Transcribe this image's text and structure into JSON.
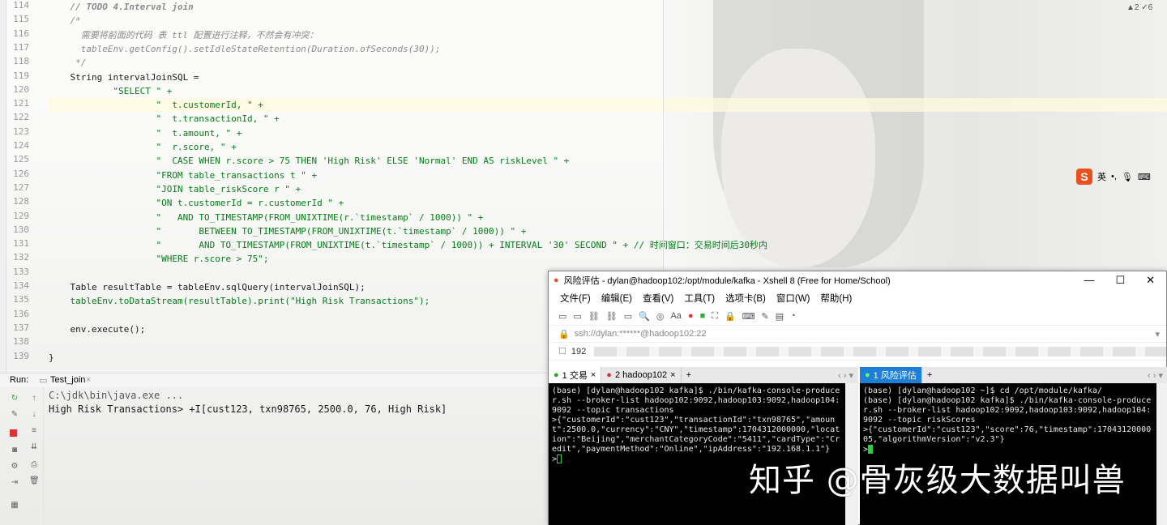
{
  "editor": {
    "line_numbers": [
      "114",
      "115",
      "116",
      "117",
      "118",
      "119",
      "120",
      "121",
      "122",
      "123",
      "124",
      "125",
      "126",
      "127",
      "128",
      "129",
      "130",
      "131",
      "132",
      "133",
      "134",
      "135",
      "136",
      "137",
      "138",
      "139"
    ],
    "lines": [
      "    // TODO 4.Interval join",
      "    /*",
      "      需要将前面的代码 表 ttl 配置进行注释，不然会有冲突：",
      "      tableEnv.getConfig().setIdleStateRetention(Duration.ofSeconds(30));",
      "     */",
      "    String intervalJoinSQL =",
      "            \"SELECT \" +",
      "                    \"  t.customerId, \" +",
      "                    \"  t.transactionId, \" +",
      "                    \"  t.amount, \" +",
      "                    \"  r.score, \" +",
      "                    \"  CASE WHEN r.score > 75 THEN 'High Risk' ELSE 'Normal' END AS riskLevel \" +",
      "                    \"FROM table_transactions t \" +",
      "                    \"JOIN table_riskScore r \" +",
      "                    \"ON t.customerId = r.customerId \" +",
      "                    \"   AND TO_TIMESTAMP(FROM_UNIXTIME(r.`timestamp` / 1000)) \" +",
      "                    \"       BETWEEN TO_TIMESTAMP(FROM_UNIXTIME(t.`timestamp` / 1000)) \" +",
      "                    \"       AND TO_TIMESTAMP(FROM_UNIXTIME(t.`timestamp` / 1000)) + INTERVAL '30' SECOND \" + // 时间窗口：交易时间后30秒内",
      "                    \"WHERE r.score > 75\";",
      "",
      "    Table resultTable = tableEnv.sqlQuery(intervalJoinSQL);",
      "    tableEnv.toDataStream(resultTable).print(\"High Risk Transactions\");",
      "",
      "    env.execute();",
      "",
      "}"
    ],
    "warnings": "▲2  ✓6"
  },
  "run_panel": {
    "label": "Run:",
    "tab": "Test_join",
    "output": [
      "C:\\jdk\\bin\\java.exe ...",
      "High Risk Transactions> +I[cust123, txn98765, 2500.0, 76, High Risk]"
    ]
  },
  "xshell": {
    "title": "风险评估 - dylan@hadoop102:/opt/module/kafka - Xshell 8 (Free for Home/School)",
    "menu": [
      "文件(F)",
      "编辑(E)",
      "查看(V)",
      "工具(T)",
      "选项卡(B)",
      "窗口(W)",
      "帮助(H)"
    ],
    "address": "ssh://dylan:******@hadoop102:22",
    "session_prefix": "192",
    "left_tabs": [
      "1 交易",
      "2 hadoop102"
    ],
    "right_tab": "1 风险评估",
    "left_term": "(base) [dylan@hadoop102 kafka]$ ./bin/kafka-console-producer.sh --broker-list hadoop102:9092,hadoop103:9092,hadoop104:9092 --topic transactions\n>{\"customerId\":\"cust123\",\"transactionId\":\"txn98765\",\"amount\":2500.0,\"currency\":\"CNY\",\"timestamp\":1704312000000,\"location\":\"Beijing\",\"merchantCategoryCode\":\"5411\",\"cardType\":\"Credit\",\"paymentMethod\":\"Online\",\"ipAddress\":\"192.168.1.1\"}\n>",
    "right_term": "(base) [dylan@hadoop102 ~]$ cd /opt/module/kafka/\n(base) [dylan@hadoop102 kafka]$ ./bin/kafka-console-producer.sh --broker-list hadoop102:9092,hadoop103:9092,hadoop104:9092 --topic riskScores\n>{\"customerId\":\"cust123\",\"score\":76,\"timestamp\":1704312000005,\"algorithmVersion\":\"v2.3\"}\n>"
  },
  "watermark": "知乎 @骨灰级大数据叫兽",
  "ime": {
    "label": "英"
  }
}
